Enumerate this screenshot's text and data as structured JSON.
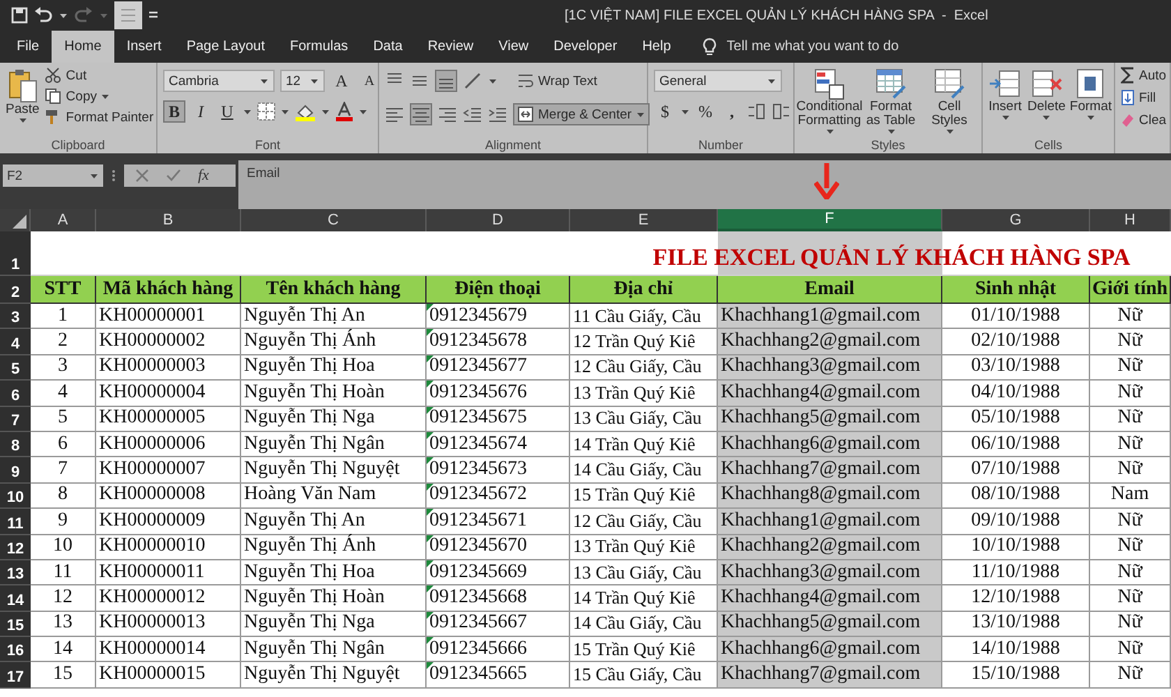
{
  "window": {
    "title": "[1C VIỆT NAM] FILE EXCEL QUẢN LÝ KHÁCH HÀNG SPA  -  Excel"
  },
  "ribbon_tabs": [
    {
      "label": "File",
      "selected": false
    },
    {
      "label": "Home",
      "selected": true
    },
    {
      "label": "Insert",
      "selected": false
    },
    {
      "label": "Page Layout",
      "selected": false
    },
    {
      "label": "Formulas",
      "selected": false
    },
    {
      "label": "Data",
      "selected": false
    },
    {
      "label": "Review",
      "selected": false
    },
    {
      "label": "View",
      "selected": false
    },
    {
      "label": "Developer",
      "selected": false
    },
    {
      "label": "Help",
      "selected": false
    }
  ],
  "tell_me": "Tell me what you want to do",
  "ribbon_groups": [
    {
      "kind": "clipboard",
      "label": "Clipboard",
      "paste": "Paste",
      "cut": "Cut",
      "copy": "Copy",
      "format_painter": "Format Painter"
    },
    {
      "kind": "font",
      "label": "Font",
      "font_name": "Cambria",
      "font_size": "12",
      "grow": "A",
      "shrink": "A",
      "bold": "B",
      "bold_on": true,
      "italic": "I",
      "underline": "U"
    },
    {
      "kind": "alignment",
      "label": "Alignment",
      "wrap_text": "Wrap Text",
      "merge_center": "Merge & Center",
      "merge_on": true
    },
    {
      "kind": "number",
      "label": "Number",
      "format": "General",
      "currency": "$",
      "percent": "%",
      "comma": ","
    },
    {
      "kind": "styles",
      "label": "Styles",
      "buttons": [
        "Conditional Formatting",
        "Format as Table",
        "Cell Styles"
      ]
    },
    {
      "kind": "cells",
      "label": "Cells",
      "buttons": [
        "Insert",
        "Delete",
        "Format"
      ]
    },
    {
      "kind": "editing",
      "items": [
        "Auto",
        "Fill",
        "Clea"
      ]
    }
  ],
  "formula_bar": {
    "name_box": "F2",
    "function_label": "fx",
    "formula": "Email"
  },
  "sheet": {
    "columns": [
      {
        "label": "A",
        "selected": false
      },
      {
        "label": "B",
        "selected": false
      },
      {
        "label": "C",
        "selected": false
      },
      {
        "label": "D",
        "selected": false
      },
      {
        "label": "E",
        "selected": false
      },
      {
        "label": "F",
        "selected": true
      },
      {
        "label": "G",
        "selected": false
      },
      {
        "label": "H",
        "selected": false
      }
    ],
    "title_row": {
      "row": "1",
      "title": "FILE EXCEL QUẢN LÝ KHÁCH HÀNG SPA"
    },
    "header_row": {
      "row": "2",
      "cells": [
        "STT",
        "Mã khách hàng",
        "Tên khách hàng",
        "Điện thoại",
        "Địa chỉ",
        "Email",
        "Sinh nhật",
        "Giới tính"
      ]
    },
    "rows": [
      {
        "row": "3",
        "phone_warning": true,
        "cells": [
          "1",
          "KH00000001",
          "Nguyễn Thị An",
          "0912345679",
          "11 Cầu Giấy, Cầu",
          "Khachhang1@gmail.com",
          "01/10/1988",
          "Nữ"
        ]
      },
      {
        "row": "4",
        "phone_warning": true,
        "cells": [
          "2",
          "KH00000002",
          "Nguyễn Thị Ánh",
          "0912345678",
          "12 Trần Quý Kiê",
          "Khachhang2@gmail.com",
          "02/10/1988",
          "Nữ"
        ]
      },
      {
        "row": "5",
        "phone_warning": true,
        "cells": [
          "3",
          "KH00000003",
          "Nguyễn Thị Hoa",
          "0912345677",
          "12 Cầu Giấy, Cầu",
          "Khachhang3@gmail.com",
          "03/10/1988",
          "Nữ"
        ]
      },
      {
        "row": "6",
        "phone_warning": true,
        "cells": [
          "4",
          "KH00000004",
          "Nguyễn Thị Hoàn",
          "0912345676",
          "13 Trần Quý Kiê",
          "Khachhang4@gmail.com",
          "04/10/1988",
          "Nữ"
        ]
      },
      {
        "row": "7",
        "phone_warning": true,
        "cells": [
          "5",
          "KH00000005",
          "Nguyễn Thị Nga",
          "0912345675",
          "13 Cầu Giấy, Cầu",
          "Khachhang5@gmail.com",
          "05/10/1988",
          "Nữ"
        ]
      },
      {
        "row": "8",
        "phone_warning": true,
        "cells": [
          "6",
          "KH00000006",
          "Nguyễn Thị Ngân",
          "0912345674",
          "14 Trần Quý Kiê",
          "Khachhang6@gmail.com",
          "06/10/1988",
          "Nữ"
        ]
      },
      {
        "row": "9",
        "phone_warning": true,
        "cells": [
          "7",
          "KH00000007",
          "Nguyễn Thị Nguyệt",
          "0912345673",
          "14 Cầu Giấy, Cầu",
          "Khachhang7@gmail.com",
          "07/10/1988",
          "Nữ"
        ]
      },
      {
        "row": "10",
        "phone_warning": true,
        "cells": [
          "8",
          "KH00000008",
          "Hoàng Văn Nam",
          "0912345672",
          "15 Trần Quý Kiê",
          "Khachhang8@gmail.com",
          "08/10/1988",
          "Nam"
        ]
      },
      {
        "row": "11",
        "phone_warning": true,
        "cells": [
          "9",
          "KH00000009",
          "Nguyễn Thị An",
          "0912345671",
          "12 Cầu Giấy, Cầu",
          "Khachhang1@gmail.com",
          "09/10/1988",
          "Nữ"
        ]
      },
      {
        "row": "12",
        "phone_warning": true,
        "cells": [
          "10",
          "KH00000010",
          "Nguyễn Thị Ánh",
          "0912345670",
          "13 Trần Quý Kiê",
          "Khachhang2@gmail.com",
          "10/10/1988",
          "Nữ"
        ]
      },
      {
        "row": "13",
        "phone_warning": true,
        "cells": [
          "11",
          "KH00000011",
          "Nguyễn Thị Hoa",
          "0912345669",
          "13 Cầu Giấy, Cầu",
          "Khachhang3@gmail.com",
          "11/10/1988",
          "Nữ"
        ]
      },
      {
        "row": "14",
        "phone_warning": true,
        "cells": [
          "12",
          "KH00000012",
          "Nguyễn Thị Hoàn",
          "0912345668",
          "14 Trần Quý Kiê",
          "Khachhang4@gmail.com",
          "12/10/1988",
          "Nữ"
        ]
      },
      {
        "row": "15",
        "phone_warning": true,
        "cells": [
          "13",
          "KH00000013",
          "Nguyễn Thị Nga",
          "0912345667",
          "14 Cầu Giấy, Cầu",
          "Khachhang5@gmail.com",
          "13/10/1988",
          "Nữ"
        ]
      },
      {
        "row": "16",
        "phone_warning": true,
        "cells": [
          "14",
          "KH00000014",
          "Nguyễn Thị Ngân",
          "0912345666",
          "15 Trần Quý Kiê",
          "Khachhang6@gmail.com",
          "14/10/1988",
          "Nữ"
        ]
      },
      {
        "row": "17",
        "phone_warning": true,
        "cells": [
          "15",
          "KH00000015",
          "Nguyễn Thị Nguyệt",
          "0912345665",
          "15 Cầu Giấy, Cầu",
          "Khachhang7@gmail.com",
          "15/10/1988",
          "Nữ"
        ]
      }
    ]
  }
}
